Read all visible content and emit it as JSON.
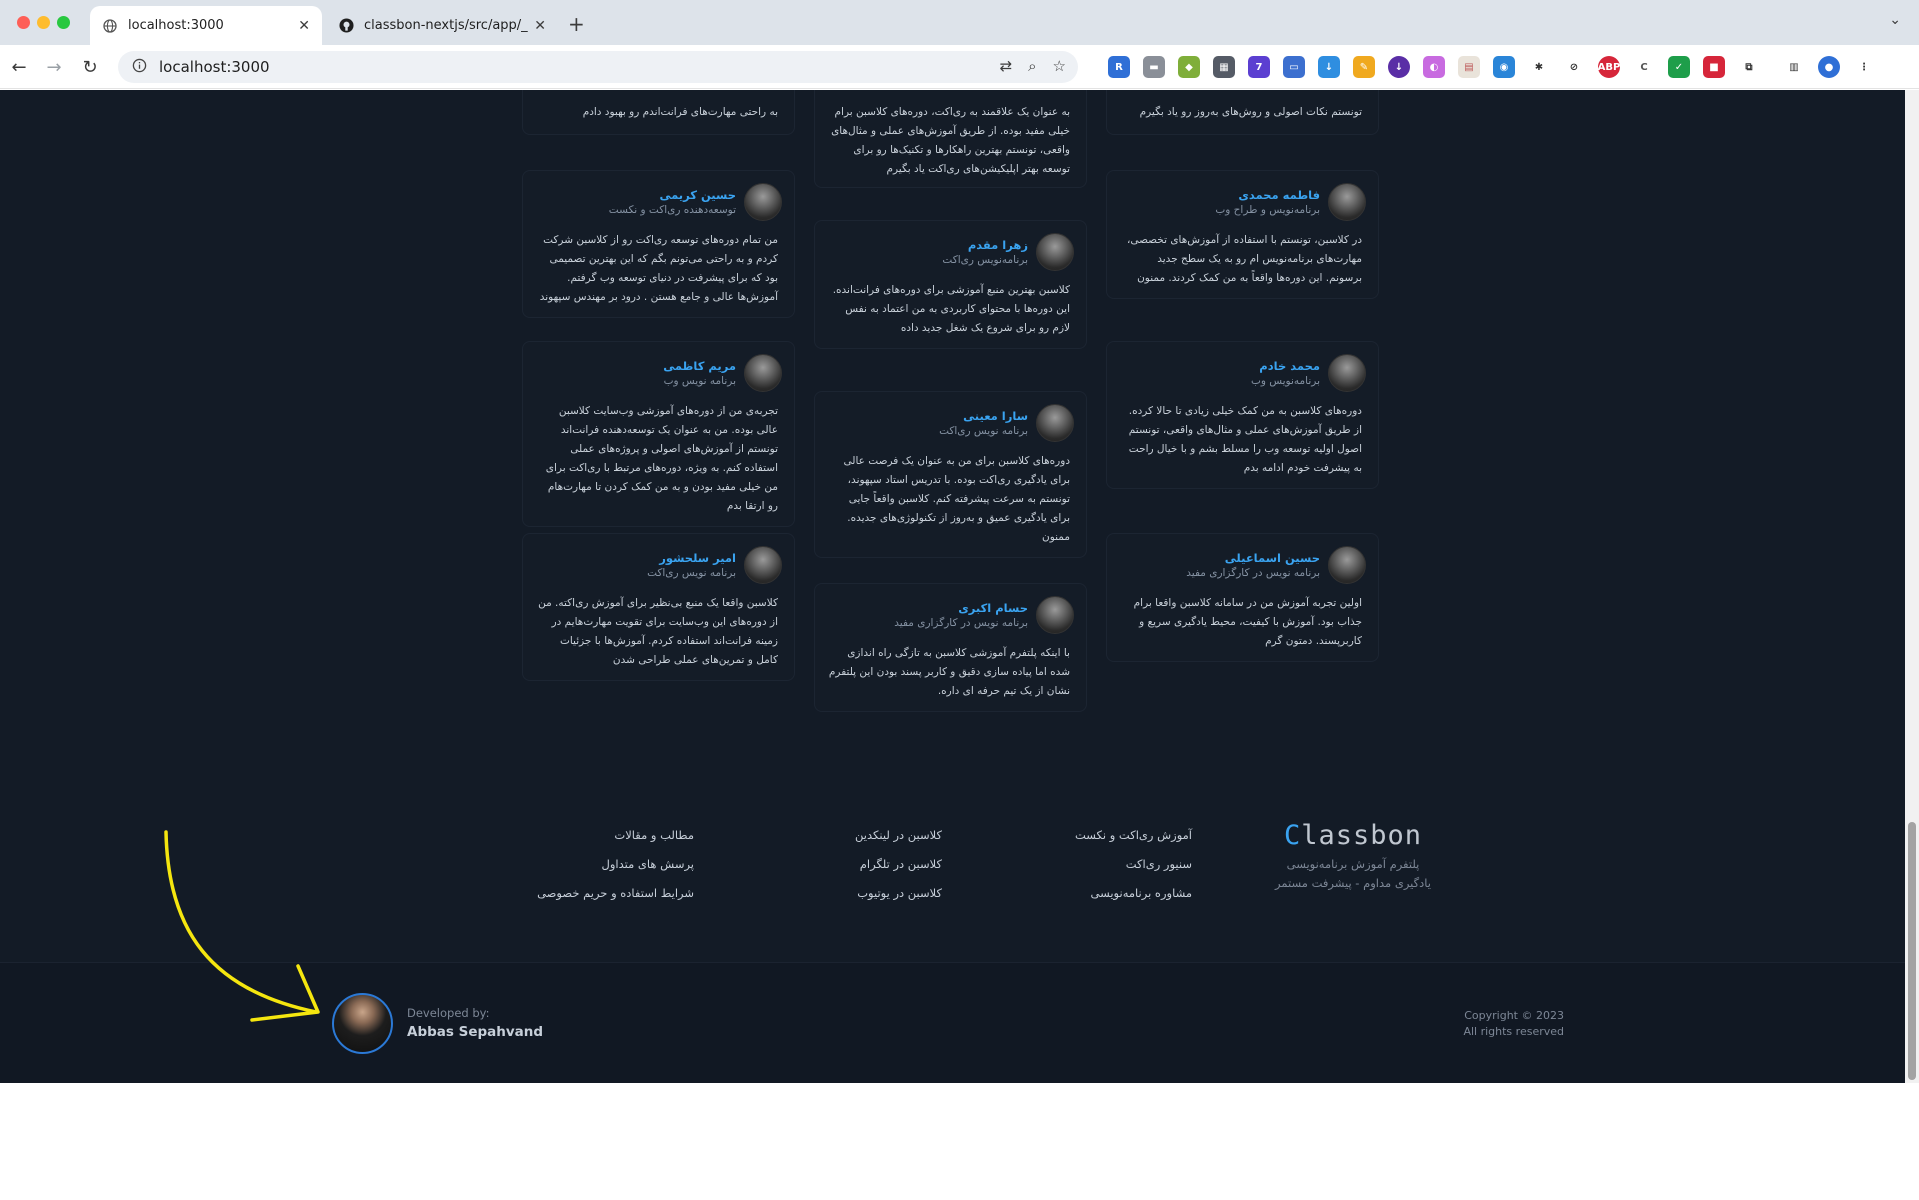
{
  "browser": {
    "tabs": [
      {
        "title": "localhost:3000",
        "favicon": "globe-icon"
      },
      {
        "title": "classbon-nextjs/src/app/_con",
        "favicon": "github-icon"
      }
    ],
    "new_tab": "+",
    "url": "localhost:3000"
  },
  "testimonials": {
    "top_fragments": {
      "col3": "به راحتی مهارت‌های فرانت‌اندم رو بهبود دادم",
      "col2": "به عنوان یک علاقمند به ری‌اکت، دوره‌های کلاسبن برام خیلی مفید بوده. از طریق آموزش‌های عملی و مثال‌های واقعی، تونستم بهترین راهکارها و تکنیک‌ها رو برای توسعه بهتر اپلیکیشن‌های ری‌اکت یاد بگیرم",
      "col1": "تونستم نکات اصولی و روش‌های به‌روز رو یاد بگیرم"
    },
    "items": [
      {
        "name": "حسین کریمی",
        "role": "توسعه‌دهنده ری‌اکت و نکست",
        "text": "من تمام دوره‌های توسعه ری‌اکت رو از کلاسبن شرکت کردم و به راحتی می‌تونم بگم که این بهترین تصمیمی بود که برای پیشرفت در دنیای توسعه وب گرفتم. آموزش‌ها عالی و جامع هستن . درود بر مهندس سپهوند"
      },
      {
        "name": "زهرا مقدم",
        "role": "برنامه‌نویس ری‌اکت",
        "text": "کلاسبن بهترین منبع آموزشی برای دوره‌های فرانت‌انده. این دوره‌ها با محتوای کاربردی به من اعتماد به نفس لازم رو برای شروع یک شغل جدید داده"
      },
      {
        "name": "فاطمه محمدی",
        "role": "برنامه‌نویس و طراح وب",
        "text": "در کلاسبن، تونستم با استفاده از آموزش‌های تخصصی، مهارت‌های برنامه‌نویس ام رو به یک سطح جدید برسونم. این دوره‌ها واقعاً به من کمک کردند. ممنون"
      },
      {
        "name": "مریم کاظمی",
        "role": "برنامه نویس وب",
        "text": "تجربه‌ی من از دوره‌های آموزشی وب‌سایت کلاسبن عالی بوده. من به عنوان یک توسعه‌دهنده فرانت‌اند تونستم از آموزش‌های اصولی و پروژه‌های عملی استفاده کنم. به ویژه، دوره‌های مرتبط با ری‌اکت برای من خیلی مفید بودن و به من کمک کردن تا مهارت‌هام رو ارتقا بدم"
      },
      {
        "name": "سارا معینی",
        "role": "برنامه نویس ری‌اکت",
        "text": "دوره‌های کلاسبن برای من به عنوان یک فرصت عالی برای یادگیری ری‌اکت بوده. با تدریس استاد سپهوند، تونستم به سرعت پیشرفته کنم. کلاسبن واقعاً جایی برای یادگیری عمیق و به‌روز از تکنولوژی‌های جدیده. ممنون"
      },
      {
        "name": "محمد خادم",
        "role": "برنامه‌نویس وب",
        "text": "دوره‌های کلاسبن به من کمک خیلی زیادی تا حالا کرده. از طریق آموزش‌های عملی و مثال‌های واقعی، تونستم اصول اولیه توسعه وب را مسلط بشم و با خیال راحت به پیشرفت خودم ادامه بدم"
      },
      {
        "name": "امیر سلحشور",
        "role": "برنامه نویس ری‌اکت",
        "text": "کلاسبن واقعا یک منبع بی‌نظیر برای آموزش ری‌اکته. من از دوره‌های این وب‌سایت برای تقویت مهارت‌هایم در زمینه فرانت‌اند استفاده کردم. آموزش‌ها با جزئیات کامل و تمرین‌های عملی طراحی شدن"
      },
      {
        "name": "حسام اکبری",
        "role": "برنامه نویس در کارگزاری مفید",
        "text": "با اینکه پلتفرم آموزشی کلاسبن به تازگی راه اندازی شده اما پیاده سازی دقیق و کاربر پسند بودن این پلتفرم نشان از یک تیم حرفه ای داره."
      },
      {
        "name": "حسین اسماعیلی",
        "role": "برنامه نویس در کارگزاری مفید",
        "text": "اولین تجربه آموزش من در سامانه کلاسبن واقعا برام جذاب بود. آموزش با کیفیت، محیط یادگیری سریع و کاربرپسند. دمتون گرم"
      }
    ]
  },
  "footer": {
    "logo_text": "Classbon",
    "tagline_1": "پلتفرم آموزش برنامه‌نویسی",
    "tagline_2": "یادگیری مداوم - پیشرفت مستمر",
    "col_services": [
      "آموزش ری‌اکت و نکست",
      "سنیور ری‌اکت",
      "مشاوره برنامه‌نویسی"
    ],
    "col_social": [
      "کلاسبن در لینکدین",
      "کلاسبن در تلگرام",
      "کلاسبن در یوتیوب"
    ],
    "col_pages": [
      "مطالب و مقالات",
      "پرسش های متداول",
      "شرایط استفاده و حریم خصوصی"
    ],
    "developed_by": "Developed by:",
    "developer_name": "Abbas Sepahvand",
    "copyright_1": "Copyright © 2023",
    "copyright_2": "All rights reserved"
  },
  "colors": {
    "accent": "#3aa3f0",
    "background": "#131b26",
    "annotation": "#f5e60f"
  }
}
